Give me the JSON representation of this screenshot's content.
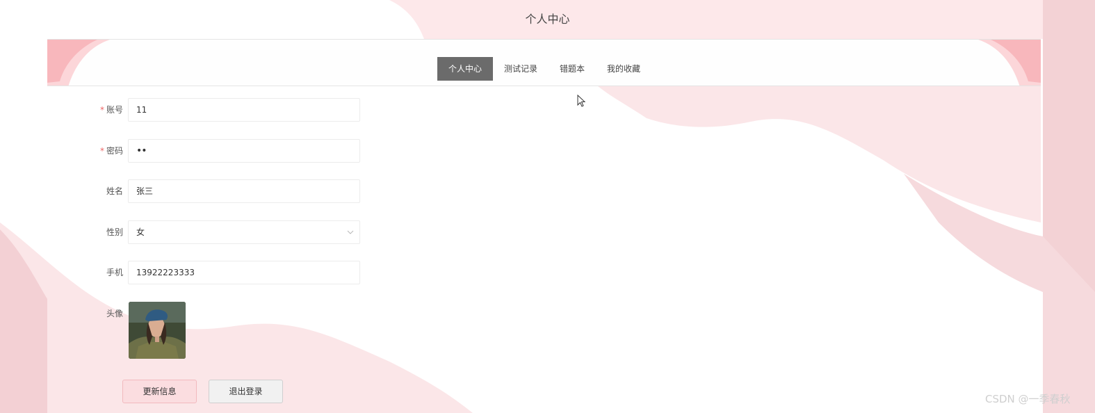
{
  "page": {
    "title": "个人中心"
  },
  "tabs": [
    {
      "label": "个人中心",
      "active": true
    },
    {
      "label": "测试记录",
      "active": false
    },
    {
      "label": "错题本",
      "active": false
    },
    {
      "label": "我的收藏",
      "active": false
    }
  ],
  "form": {
    "account": {
      "label": "账号",
      "required": "*",
      "value": "11"
    },
    "password": {
      "label": "密码",
      "required": "*",
      "value": "••"
    },
    "name": {
      "label": "姓名",
      "value": "张三"
    },
    "gender": {
      "label": "性别",
      "value": "女",
      "icon": "chevron-down-icon"
    },
    "phone": {
      "label": "手机",
      "value": "13922223333"
    },
    "avatar": {
      "label": "头像"
    }
  },
  "buttons": {
    "update": "更新信息",
    "logout": "退出登录"
  },
  "watermark": "CSDN @一季春秋",
  "colors": {
    "accent_pink": "#fbdde0",
    "tab_active": "#6b6b6b",
    "wave_pink": "#fbe3e5"
  }
}
